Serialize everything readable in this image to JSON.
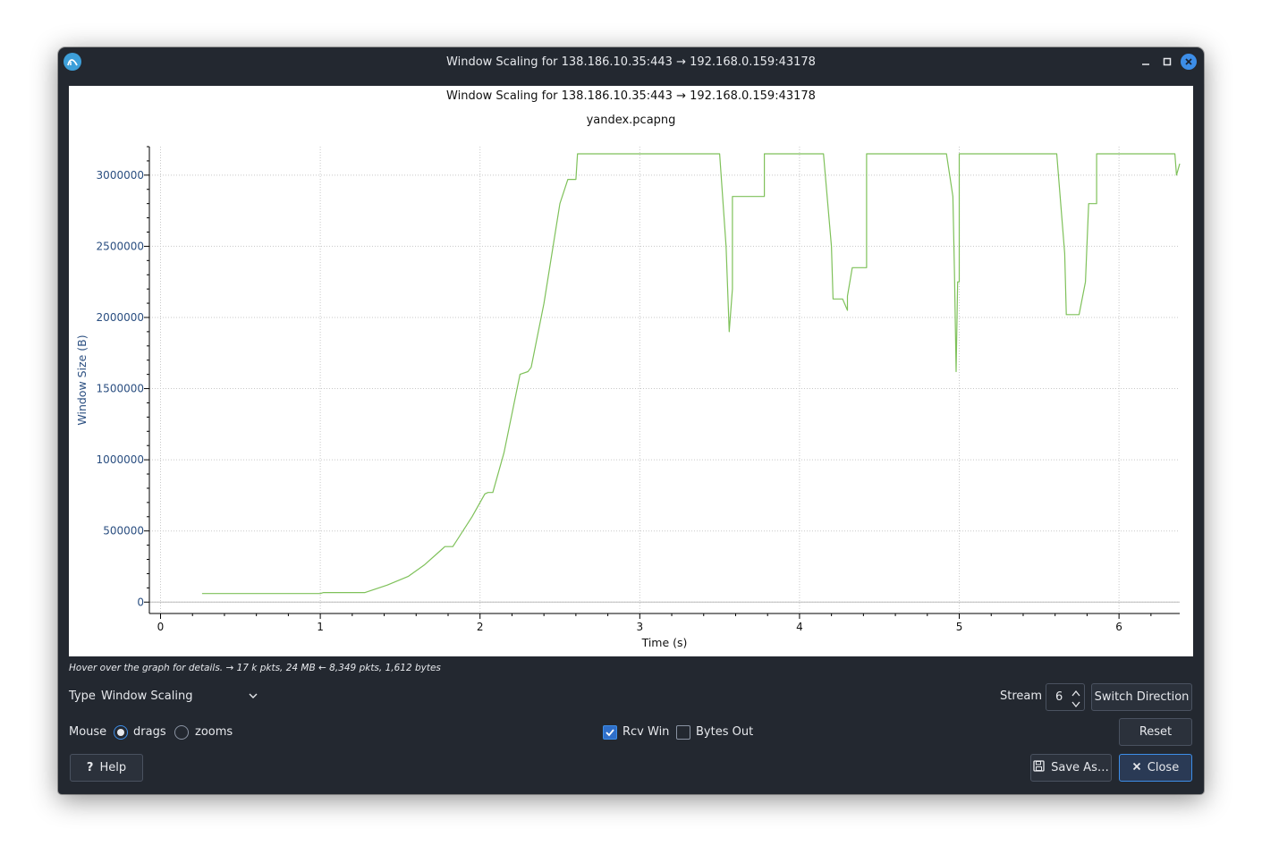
{
  "window": {
    "title": "Window Scaling for 138.186.10.35:443 → 192.168.0.159:43178"
  },
  "graph": {
    "title": "Window Scaling for 138.186.10.35:443 → 192.168.0.159:43178",
    "subtitle": "yandex.pcapng"
  },
  "hint_text": "Hover over the graph for details. → 17 k pkts, 24 MB ← 8,349 pkts, 1,612 bytes",
  "controls": {
    "type_label": "Type",
    "type_value": "Window Scaling",
    "stream_label": "Stream",
    "stream_value": "6",
    "switch_direction": "Switch Direction",
    "mouse_label": "Mouse",
    "mouse_drags": "drags",
    "mouse_zooms": "zooms",
    "mouse_selected": "drags",
    "rcv_win_label": "Rcv Win",
    "rcv_win_checked": true,
    "bytes_out_label": "Bytes Out",
    "bytes_out_checked": false,
    "reset": "Reset",
    "help": "Help",
    "save_as": "Save As…",
    "close": "Close"
  },
  "colors": {
    "series": "#7fc15a",
    "axis_label": "#2a4e80",
    "accent": "#3d8ee8"
  },
  "chart_data": {
    "type": "line",
    "xlabel": "Time (s)",
    "ylabel": "Window Size (B)",
    "xlim": [
      -0.07,
      6.38
    ],
    "ylim": [
      -80000,
      3200000
    ],
    "xticks": [
      0,
      1,
      2,
      3,
      4,
      5,
      6
    ],
    "yticks": [
      0,
      500000,
      1000000,
      1500000,
      2000000,
      2500000,
      3000000
    ],
    "ytick_labels": [
      "0",
      "500000",
      "1000000",
      "1500000",
      "2000000",
      "2500000",
      "3000000"
    ],
    "grid": true,
    "series": [
      {
        "name": "Rcv Win",
        "x": [
          0.26,
          1.0,
          1.02,
          1.28,
          1.42,
          1.55,
          1.65,
          1.75,
          1.78,
          1.83,
          1.95,
          2.03,
          2.05,
          2.08,
          2.15,
          2.25,
          2.3,
          2.32,
          2.4,
          2.5,
          2.55,
          2.6,
          2.61,
          3.5,
          3.54,
          3.56,
          3.58,
          3.58,
          3.78,
          3.78,
          4.15,
          4.2,
          4.21,
          4.27,
          4.3,
          4.3,
          4.33,
          4.42,
          4.42,
          4.92,
          4.96,
          4.97,
          4.98,
          4.99,
          5.0,
          5.0,
          5.02,
          5.61,
          5.66,
          5.67,
          5.75,
          5.79,
          5.81,
          5.81,
          5.86,
          5.86,
          6.35,
          6.36,
          6.38
        ],
        "y": [
          60000,
          60000,
          67000,
          67000,
          120000,
          180000,
          260000,
          360000,
          390000,
          390000,
          600000,
          760000,
          770000,
          770000,
          1050000,
          1600000,
          1620000,
          1650000,
          2100000,
          2800000,
          2970000,
          2970000,
          3150000,
          3150000,
          2500000,
          1900000,
          2200000,
          2850000,
          2850000,
          3150000,
          3150000,
          2500000,
          2130000,
          2130000,
          2050000,
          2150000,
          2350000,
          2350000,
          3150000,
          3150000,
          2850000,
          2300000,
          1620000,
          2250000,
          2250000,
          3150000,
          3150000,
          3150000,
          2450000,
          2020000,
          2020000,
          2250000,
          2800000,
          2800000,
          2800000,
          3150000,
          3150000,
          3000000,
          3080000
        ]
      }
    ]
  }
}
